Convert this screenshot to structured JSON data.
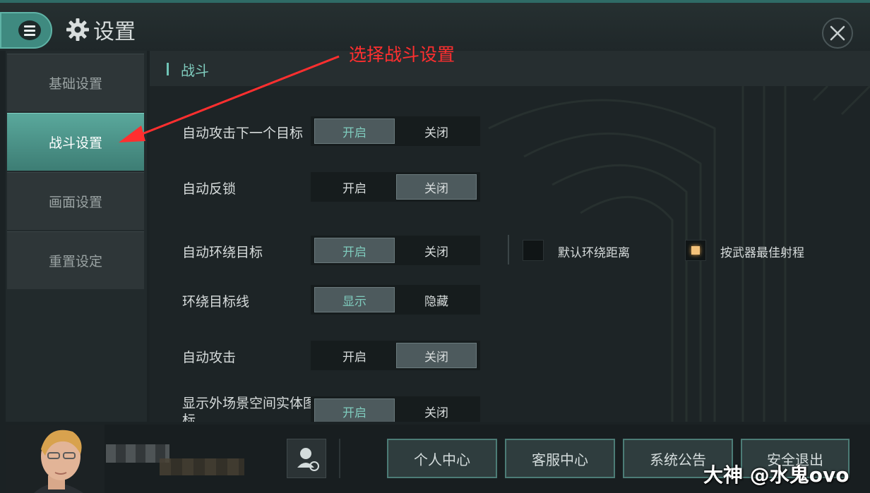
{
  "header": {
    "title": "设置"
  },
  "sidebar": {
    "items": [
      {
        "label": "基础设置"
      },
      {
        "label": "战斗设置"
      },
      {
        "label": "画面设置"
      },
      {
        "label": "重置设定"
      }
    ]
  },
  "main": {
    "section_title": "战斗",
    "rows": [
      {
        "label": "自动攻击下一个目标",
        "left": "开启",
        "right": "关闭",
        "selected": "left"
      },
      {
        "label": "自动反锁",
        "left": "开启",
        "right": "关闭",
        "selected": "right"
      },
      {
        "label": "自动环绕目标",
        "left": "开启",
        "right": "关闭",
        "selected": "left"
      },
      {
        "label": "环绕目标线",
        "left": "显示",
        "right": "隐藏",
        "selected": "left"
      },
      {
        "label": "自动攻击",
        "left": "开启",
        "right": "关闭",
        "selected": "right"
      },
      {
        "label": "显示外场景空间实体图标",
        "left": "开启",
        "right": "关闭",
        "selected": "left"
      }
    ],
    "orbit_options": [
      {
        "label": "默认环绕距离",
        "checked": false
      },
      {
        "label": "按武器最佳射程",
        "checked": true
      }
    ]
  },
  "annotation": {
    "text": "选择战斗设置",
    "color": "#ff2f2f"
  },
  "bottom": {
    "buttons": [
      {
        "label": "个人中心"
      },
      {
        "label": "客服中心"
      },
      {
        "label": "系统公告"
      },
      {
        "label": "安全退出"
      }
    ]
  },
  "watermark": "大神 @水鬼ovo",
  "colors": {
    "accent": "#5aa89c",
    "teal_text": "#7fcbbd",
    "checkbox_on": "#f4c27a"
  }
}
